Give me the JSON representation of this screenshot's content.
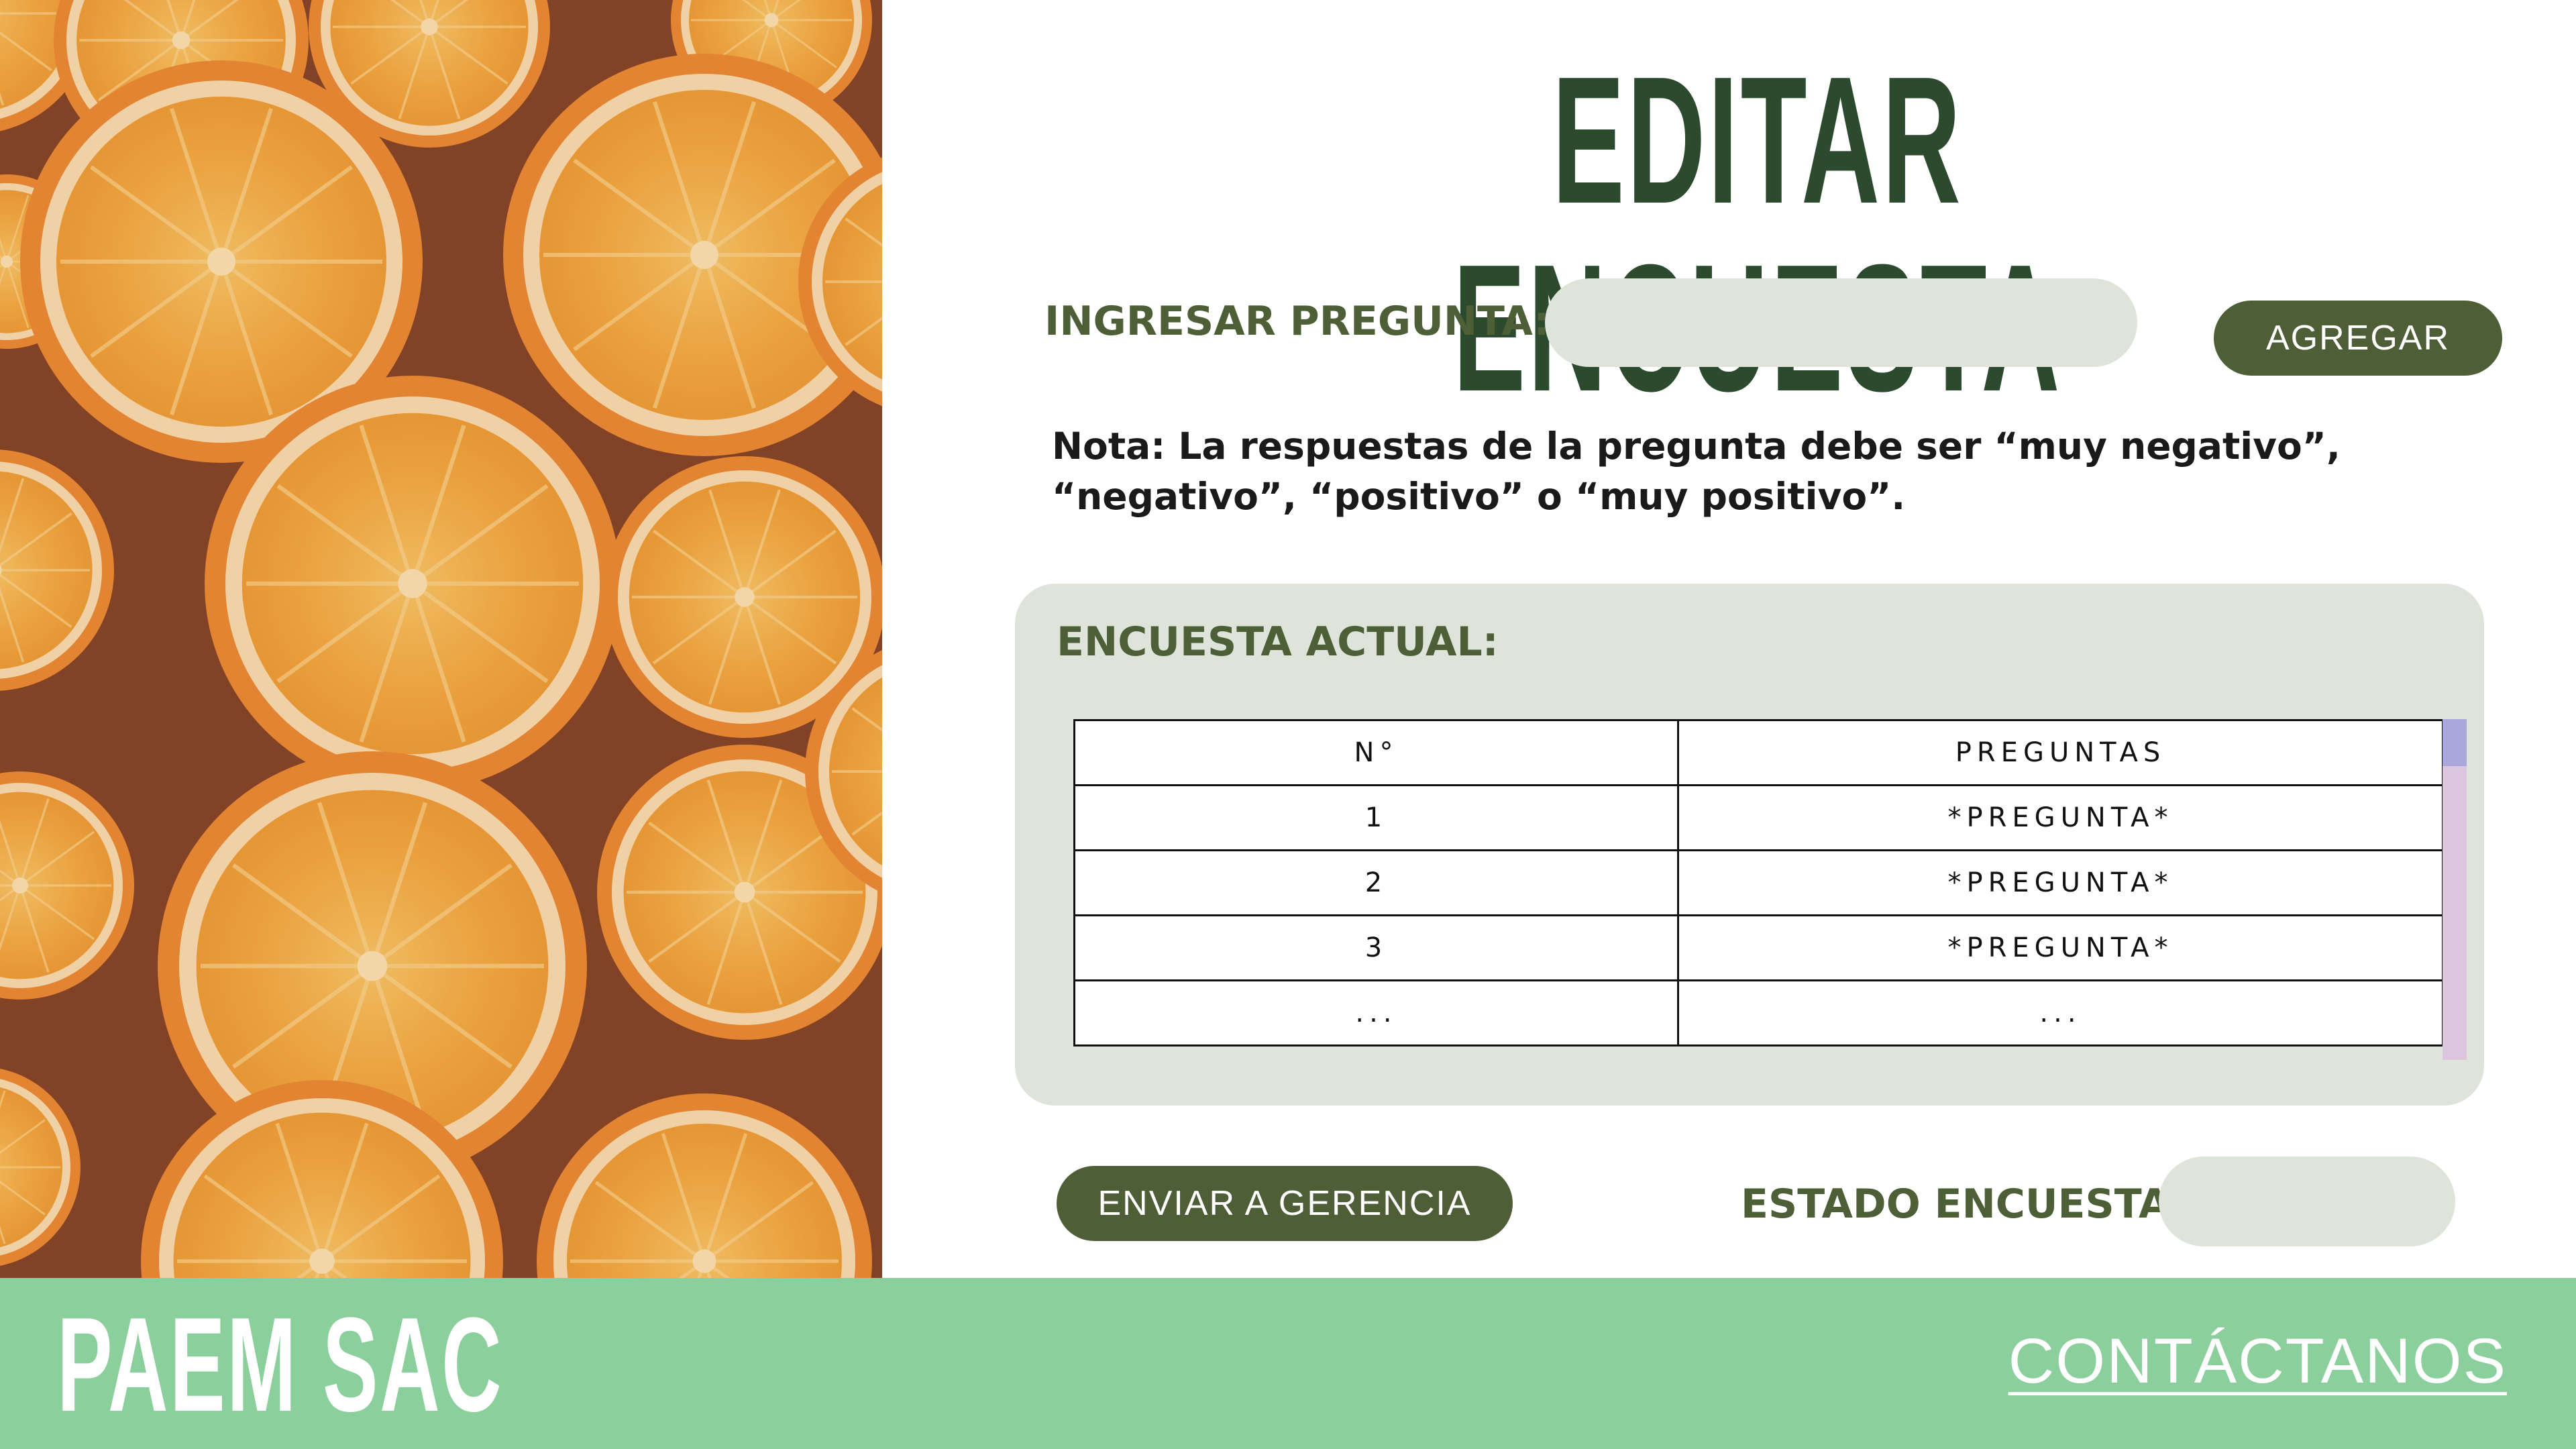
{
  "title": "EDITAR ENCUESTA",
  "question_form": {
    "label": "INGRESAR PREGUNTA:",
    "input_value": "",
    "add_button": "AGREGAR"
  },
  "note": "Nota: La respuestas de la pregunta debe ser “muy negativo”, “negativo”, “positivo” o  “muy positivo”.",
  "survey": {
    "label": "ENCUESTA ACTUAL:",
    "columns": [
      "N°",
      "PREGUNTAS"
    ],
    "rows": [
      [
        "1",
        "*PREGUNTA*"
      ],
      [
        "2",
        "*PREGUNTA*"
      ],
      [
        "3",
        "*PREGUNTA*"
      ],
      [
        "...",
        "..."
      ]
    ]
  },
  "send_button": "ENVIAR A GERENCIA",
  "status": {
    "label": "ESTADO ENCUESTA:",
    "value": ""
  },
  "footer": {
    "brand": "PAEM SAC",
    "contact": "CONTÁCTANOS"
  },
  "colors": {
    "title": "#2b4a2e",
    "accent": "#4e5f37",
    "field_bg": "#dfe4da",
    "footer_bg": "#8bcf9c"
  }
}
